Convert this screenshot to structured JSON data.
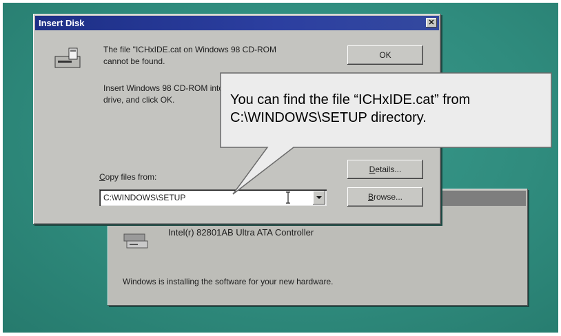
{
  "background_dialog": {
    "device_name": "Intel(r) 82801AB Ultra ATA Controller",
    "status": "Windows is installing the software for your new hardware."
  },
  "dialog": {
    "title": "Insert Disk",
    "close_symbol": "✕",
    "message1": "The file \"ICHxIDE.cat on Windows 98 CD-ROM cannot be found.",
    "message2": "Insert Windows 98 CD-ROM into the selected drive, and click OK.",
    "buttons": {
      "ok": "OK",
      "details_first": "D",
      "details_rest": "etails...",
      "browse_first": "B",
      "browse_rest": "rowse..."
    },
    "copy_label_first": "C",
    "copy_label_rest": "opy files from:",
    "path_value": "C:\\WINDOWS\\SETUP"
  },
  "callout": {
    "line1": "You can find the file “ICHxIDE.cat” from",
    "line2": "C:\\WINDOWS\\SETUP directory."
  },
  "colors": {
    "desktop": "#2f8b7d",
    "titlebar": "#1d2f86",
    "dialog_face": "#c4c4c0"
  },
  "icons": [
    "disk-drive-icon",
    "controller-device-icon",
    "close-icon",
    "chevron-down-icon",
    "text-cursor-icon"
  ]
}
